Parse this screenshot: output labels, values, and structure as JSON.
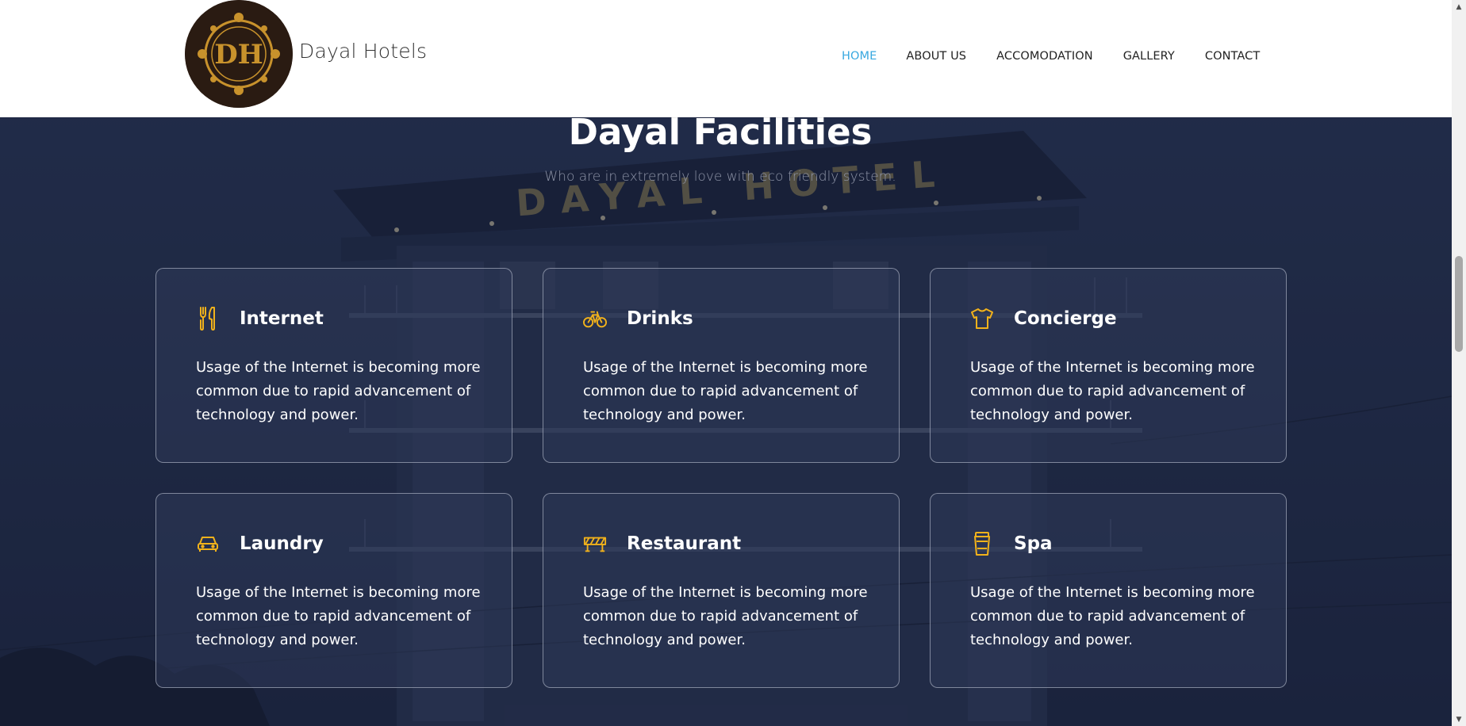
{
  "brand": {
    "name": "Dayal Hotels"
  },
  "nav": {
    "items": [
      {
        "label": "HOME",
        "active": true
      },
      {
        "label": "ABOUT US",
        "active": false
      },
      {
        "label": "ACCOMODATION",
        "active": false
      },
      {
        "label": "GALLERY",
        "active": false
      },
      {
        "label": "CONTACT",
        "active": false
      }
    ]
  },
  "section": {
    "title": "Dayal Facilities",
    "subtitle": "Who are in extremely love with eco friendly system."
  },
  "background": {
    "sign_text": "DAYAL HOTEL"
  },
  "facilities": [
    {
      "title": "Internet",
      "icon": "fork-knife-icon",
      "text": "Usage of the Internet is becoming more common due to rapid advancement of technology and power."
    },
    {
      "title": "Drinks",
      "icon": "bicycle-icon",
      "text": "Usage of the Internet is becoming more common due to rapid advancement of technology and power."
    },
    {
      "title": "Concierge",
      "icon": "shirt-icon",
      "text": "Usage of the Internet is becoming more common due to rapid advancement of technology and power."
    },
    {
      "title": "Laundry",
      "icon": "car-icon",
      "text": "Usage of the Internet is becoming more common due to rapid advancement of technology and power."
    },
    {
      "title": "Restaurant",
      "icon": "barrier-icon",
      "text": "Usage of the Internet is becoming more common due to rapid advancement of technology and power."
    },
    {
      "title": "Spa",
      "icon": "cup-icon",
      "text": "Usage of the Internet is becoming more common due to rapid advancement of technology and power."
    }
  ],
  "colors": {
    "accent": "#38a8e0",
    "icon": "#f2b21b",
    "card_border": "#c8cddc",
    "header_bg": "#ffffff",
    "logo_bg": "#2a1b12",
    "logo_gold": "#c8922c"
  }
}
